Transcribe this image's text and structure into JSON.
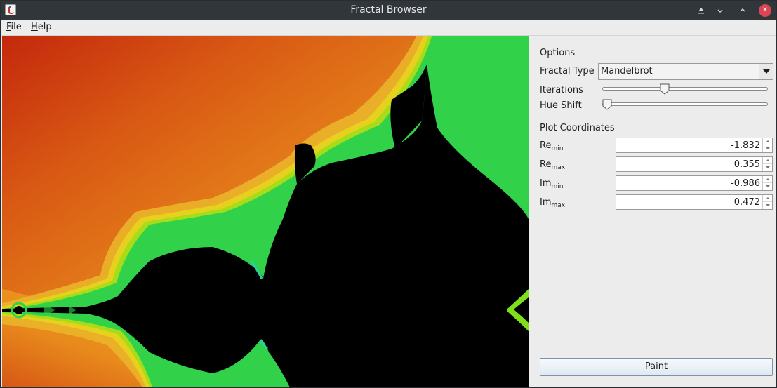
{
  "window": {
    "title": "Fractal Browser",
    "close_glyph": "✕"
  },
  "menu": {
    "file": {
      "mnemonic": "F",
      "rest": "ile"
    },
    "help": {
      "mnemonic": "H",
      "rest": "elp"
    }
  },
  "options": {
    "section_title": "Options",
    "fractal_type_label": "Fractal Type",
    "fractal_type_value": "Mandelbrot",
    "iterations_label": "Iterations",
    "iterations_fraction": 0.37,
    "hue_shift_label": "Hue Shift",
    "hue_shift_fraction": 0.0
  },
  "coordinates": {
    "section_title": "Plot Coordinates",
    "items": [
      {
        "base": "Re",
        "sub": "min",
        "value": "-1.832"
      },
      {
        "base": "Re",
        "sub": "max",
        "value": "0.355"
      },
      {
        "base": "Im",
        "sub": "min",
        "value": "-0.986"
      },
      {
        "base": "Im",
        "sub": "max",
        "value": "0.472"
      }
    ]
  },
  "paint_label": "Paint",
  "icons": [
    "app-icon",
    "keep-above-icon",
    "minimize-icon",
    "maximize-icon",
    "close-icon",
    "dropdown-arrow-icon",
    "spinner-up-icon",
    "spinner-down-icon"
  ],
  "colors": {
    "titlebar": "#31363b",
    "close": "#da4453",
    "panel": "#ececec"
  }
}
